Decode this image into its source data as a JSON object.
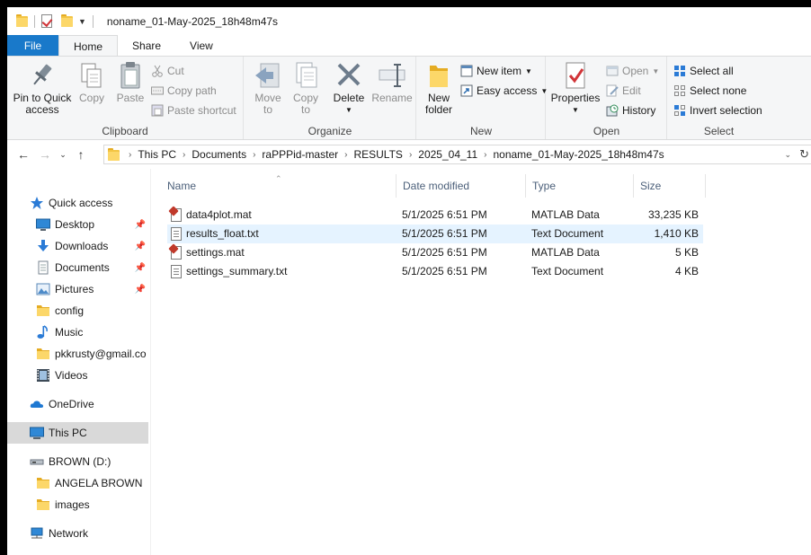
{
  "window": {
    "title": "noname_01-May-2025_18h48m47s"
  },
  "tabs": [
    {
      "label": "File"
    },
    {
      "label": "Home"
    },
    {
      "label": "Share"
    },
    {
      "label": "View"
    }
  ],
  "ribbon": {
    "clipboard": {
      "label": "Clipboard",
      "pin_line1": "Pin to Quick",
      "pin_line2": "access",
      "copy": "Copy",
      "paste": "Paste",
      "cut": "Cut",
      "copy_path": "Copy path",
      "paste_shortcut": "Paste shortcut"
    },
    "organize": {
      "label": "Organize",
      "move_line1": "Move",
      "move_line2": "to",
      "copy_line1": "Copy",
      "copy_line2": "to",
      "delete": "Delete",
      "rename": "Rename"
    },
    "new": {
      "label": "New",
      "new_folder_line1": "New",
      "new_folder_line2": "folder",
      "new_item": "New item",
      "easy_access": "Easy access"
    },
    "open": {
      "label": "Open",
      "properties": "Properties",
      "open": "Open",
      "edit": "Edit",
      "history": "History"
    },
    "select": {
      "label": "Select",
      "select_all": "Select all",
      "select_none": "Select none",
      "invert_selection": "Invert selection"
    }
  },
  "address": {
    "crumbs": [
      "This PC",
      "Documents",
      "raPPPid-master",
      "RESULTS",
      "2025_04_11",
      "noname_01-May-2025_18h48m47s"
    ]
  },
  "navpane": {
    "items": [
      {
        "label": "Quick access"
      },
      {
        "label": "Desktop"
      },
      {
        "label": "Downloads"
      },
      {
        "label": "Documents"
      },
      {
        "label": "Pictures"
      },
      {
        "label": "config"
      },
      {
        "label": "Music"
      },
      {
        "label": "pkkrusty@gmail.co"
      },
      {
        "label": "Videos"
      },
      {
        "label": "OneDrive"
      },
      {
        "label": "This PC"
      },
      {
        "label": "BROWN (D:)"
      },
      {
        "label": "ANGELA BROWN"
      },
      {
        "label": "images"
      },
      {
        "label": "Network"
      }
    ]
  },
  "filelist": {
    "columns": {
      "name": "Name",
      "date": "Date modified",
      "type": "Type",
      "size": "Size"
    },
    "rows": [
      {
        "name": "data4plot.mat",
        "date": "5/1/2025 6:51 PM",
        "type": "MATLAB Data",
        "size": "33,235 KB",
        "icon": "matlab-file-icon"
      },
      {
        "name": "results_float.txt",
        "date": "5/1/2025 6:51 PM",
        "type": "Text Document",
        "size": "1,410 KB",
        "icon": "text-file-icon"
      },
      {
        "name": "settings.mat",
        "date": "5/1/2025 6:51 PM",
        "type": "MATLAB Data",
        "size": "5 KB",
        "icon": "matlab-file-icon"
      },
      {
        "name": "settings_summary.txt",
        "date": "5/1/2025 6:51 PM",
        "type": "Text Document",
        "size": "4 KB",
        "icon": "text-file-icon"
      }
    ]
  },
  "colors": {
    "file_tab": "#1979ca",
    "hover_row": "#e5f3ff",
    "selected_nav": "#d9d9d9",
    "folder": "#fcd769"
  }
}
